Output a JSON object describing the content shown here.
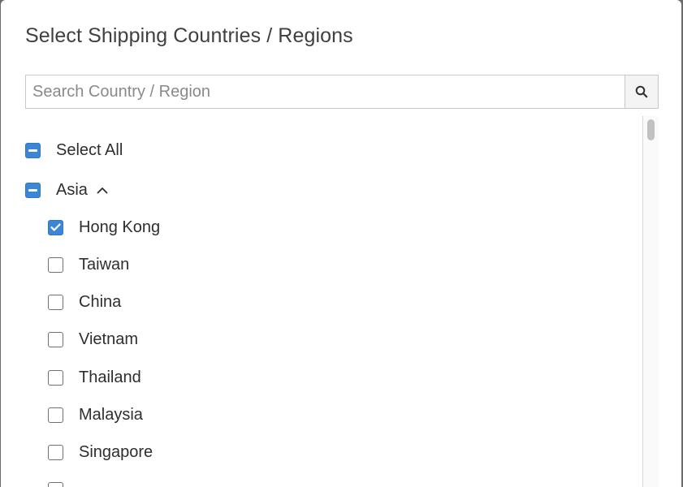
{
  "dialog": {
    "title": "Select Shipping Countries / Regions"
  },
  "search": {
    "placeholder": "Search Country / Region",
    "value": "",
    "icon": "search-icon"
  },
  "tree": {
    "select_all": {
      "label": "Select All",
      "state": "indeterminate"
    },
    "groups": [
      {
        "label": "Asia",
        "state": "indeterminate",
        "expanded": true,
        "items": [
          {
            "label": "Hong Kong",
            "checked": true
          },
          {
            "label": "Taiwan",
            "checked": false
          },
          {
            "label": "China",
            "checked": false
          },
          {
            "label": "Vietnam",
            "checked": false
          },
          {
            "label": "Thailand",
            "checked": false
          },
          {
            "label": "Malaysia",
            "checked": false
          },
          {
            "label": "Singapore",
            "checked": false
          }
        ]
      }
    ]
  },
  "colors": {
    "accent": "#3b86d6",
    "checkbox_border": "#707070",
    "title_text": "#404040",
    "body_text": "#2e2e2e"
  }
}
